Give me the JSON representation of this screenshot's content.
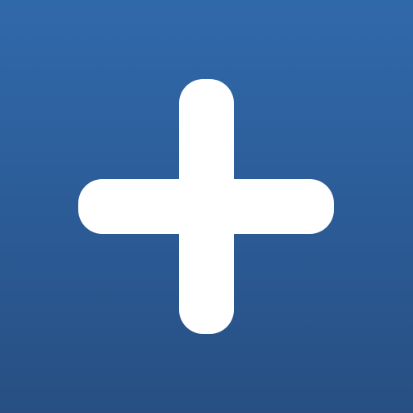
{
  "icon": {
    "name": "plus-icon",
    "background_top": "#3069ab",
    "background_bottom": "#274f83",
    "glyph_color": "#ffffff"
  }
}
